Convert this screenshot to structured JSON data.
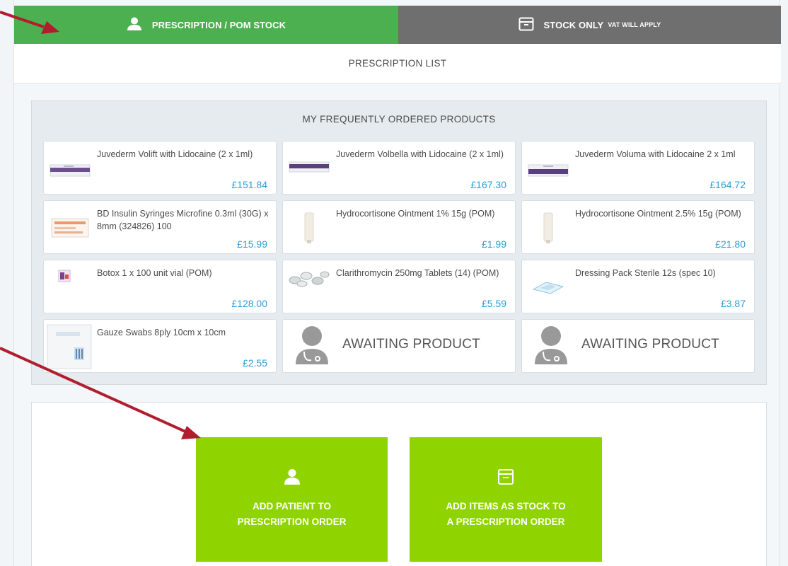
{
  "tabs": {
    "pom": {
      "label": "PRESCRIPTION / POM STOCK",
      "icon": "user-icon",
      "color": "#4caf50"
    },
    "stock": {
      "label": "STOCK ONLY",
      "sublabel": "VAT WILL APPLY",
      "icon": "archive-box-icon",
      "color": "#6f6f6f"
    }
  },
  "prescription_list": {
    "label": "PRESCRIPTION LIST"
  },
  "frequent": {
    "title": "MY FREQUENTLY ORDERED PRODUCTS",
    "products": [
      {
        "name": "Juvederm Volift with Lidocaine (2 x 1ml)",
        "price": "£151.84",
        "thumb": "filler-box-icon"
      },
      {
        "name": "Juvederm Volbella with Lidocaine (2 x 1ml)",
        "price": "£167.30",
        "thumb": "filler-box-icon"
      },
      {
        "name": "Juvederm Voluma with Lidocaine 2 x 1ml",
        "price": "£164.72",
        "thumb": "filler-box-icon"
      },
      {
        "name": "BD Insulin Syringes Microfine 0.3ml (30G) x 8mm (324826) 100",
        "price": "£15.99",
        "thumb": "syringe-pack-icon"
      },
      {
        "name": "Hydrocortisone Ointment 1% 15g (POM)",
        "price": "£1.99",
        "thumb": "ointment-tube-icon"
      },
      {
        "name": "Hydrocortisone Ointment 2.5% 15g (POM)",
        "price": "£21.80",
        "thumb": "ointment-tube-icon"
      },
      {
        "name": "Botox 1 x 100 unit vial (POM)",
        "price": "£128.00",
        "thumb": "vial-box-icon"
      },
      {
        "name": "Clarithromycin 250mg Tablets (14) (POM)",
        "price": "£5.59",
        "thumb": "tablets-icon"
      },
      {
        "name": "Dressing Pack Sterile 12s (spec 10)",
        "price": "£3.87",
        "thumb": "dressing-pack-icon"
      },
      {
        "name": "Gauze Swabs 8ply 10cm x 10cm",
        "price": "£2.55",
        "thumb": "gauze-box-icon"
      }
    ],
    "awaiting": [
      {
        "label": "AWAITING PRODUCT",
        "icon": "doctor-avatar-icon"
      },
      {
        "label": "AWAITING PRODUCT",
        "icon": "doctor-avatar-icon"
      }
    ]
  },
  "actions": {
    "add_patient": {
      "line1": "ADD PATIENT TO",
      "line2": "PRESCRIPTION ORDER",
      "icon": "user-icon"
    },
    "add_stock": {
      "line1": "ADD ITEMS AS STOCK TO",
      "line2": "A PRESCRIPTION ORDER",
      "icon": "archive-box-icon"
    },
    "color": "#8fd400"
  },
  "annotation_color": "#b01e2e"
}
